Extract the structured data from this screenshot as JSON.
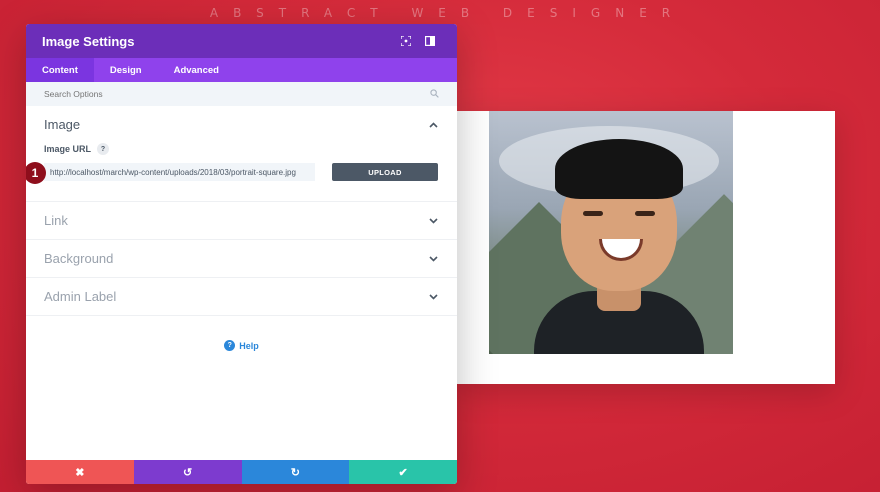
{
  "brand": "ABSTRACT WEB DESIGNER",
  "modal": {
    "title": "Image Settings",
    "icons": [
      "focus-icon",
      "sidebar-layout-icon"
    ],
    "tabs": [
      {
        "label": "Content",
        "active": true
      },
      {
        "label": "Design",
        "active": false
      },
      {
        "label": "Advanced",
        "active": false
      }
    ],
    "search": {
      "placeholder": "Search Options"
    },
    "sections": {
      "image": {
        "title": "Image",
        "expanded": true,
        "field_label": "Image URL",
        "help_mark": "?",
        "url_value": "http://localhost/march/wp-content/uploads/2018/03/portrait-square.jpg",
        "upload_label": "UPLOAD",
        "step_badge": "1"
      },
      "link": {
        "title": "Link"
      },
      "background": {
        "title": "Background"
      },
      "admin_label": {
        "title": "Admin Label"
      }
    },
    "help": {
      "label": "Help",
      "icon_glyph": "?"
    },
    "footer": {
      "cancel": {
        "glyph": "✖",
        "color": "#ef5555"
      },
      "undo": {
        "glyph": "↺",
        "color": "#7d3bcf"
      },
      "redo": {
        "glyph": "↻",
        "color": "#2b87da"
      },
      "save": {
        "glyph": "✔",
        "color": "#29c4a9"
      }
    }
  },
  "colors": {
    "header": "#6c2eb9",
    "tabs": "#8f42ec",
    "accent_blue": "#2b87da",
    "background_red": "#d42a3a"
  }
}
